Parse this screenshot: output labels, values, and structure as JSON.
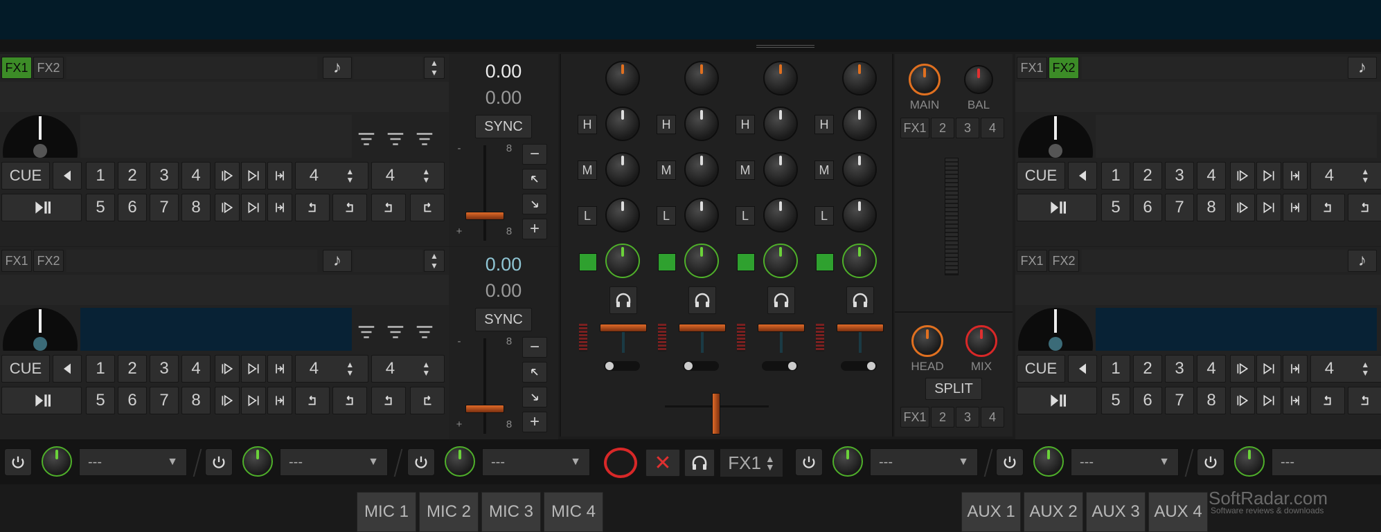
{
  "deck_a": {
    "fx1": "FX1",
    "fx2": "FX2",
    "note_icon": "♪",
    "bpm": "0.00",
    "pitch": "0.00",
    "sync": "SYNC",
    "cue": "CUE",
    "hotcues_top": [
      "1",
      "2",
      "3",
      "4"
    ],
    "hotcues_bottom": [
      "5",
      "6",
      "7",
      "8"
    ],
    "loop_a": "4",
    "loop_b": "4",
    "pitch_top": "8",
    "pitch_bottom": "8",
    "pitch_minus": "-",
    "pitch_plus": "+",
    "fx_slot1_on": true
  },
  "deck_b": {
    "fx1": "FX1",
    "fx2": "FX2",
    "note_icon": "♪",
    "bpm": "0.00",
    "pitch": "0.00",
    "sync": "SYNC",
    "cue": "CUE",
    "hotcues_top": [
      "1",
      "2",
      "3",
      "4"
    ],
    "hotcues_bottom": [
      "5",
      "6",
      "7",
      "8"
    ],
    "loop_a": "4",
    "loop_b": "4",
    "pitch_top": "8",
    "pitch_bottom": "8",
    "pitch_minus": "-",
    "pitch_plus": "+"
  },
  "deck_c": {
    "fx1": "FX1",
    "fx2": "FX2",
    "note_icon": "♪",
    "cue": "CUE",
    "hotcues_top": [
      "1",
      "2",
      "3",
      "4"
    ],
    "hotcues_bottom": [
      "5",
      "6",
      "7",
      "8"
    ],
    "loop_a": "4",
    "fx_slot2_on": true
  },
  "deck_d": {
    "fx1": "FX1",
    "fx2": "FX2",
    "note_icon": "♪",
    "cue": "CUE",
    "hotcues_top": [
      "1",
      "2",
      "3",
      "4"
    ],
    "hotcues_bottom": [
      "5",
      "6",
      "7",
      "8"
    ],
    "loop_a": "4"
  },
  "mixer": {
    "eq_labels": [
      "H",
      "M",
      "L"
    ],
    "channels": 4
  },
  "master": {
    "main": "MAIN",
    "bal": "BAL",
    "head": "HEAD",
    "mix": "MIX",
    "split": "SPLIT",
    "fx_top": [
      "FX1",
      "2",
      "3",
      "4"
    ],
    "fx_bottom": [
      "FX1",
      "2",
      "3",
      "4"
    ]
  },
  "effects_bar": {
    "dropdown_value": "---",
    "fx_select": "FX1",
    "units": 6
  },
  "tabs": {
    "mic": [
      "MIC 1",
      "MIC 2",
      "MIC 3",
      "MIC 4"
    ],
    "aux": [
      "AUX 1",
      "AUX 2",
      "AUX 3",
      "AUX 4"
    ]
  },
  "watermark": {
    "title": "SoftRadar.com",
    "subtitle": "Software reviews & downloads"
  },
  "colors": {
    "accent_green": "#3c8c27",
    "accent_orange": "#e07020",
    "accent_red": "#d82828",
    "topbar": "#031b28",
    "wave_blue": "#082235"
  }
}
